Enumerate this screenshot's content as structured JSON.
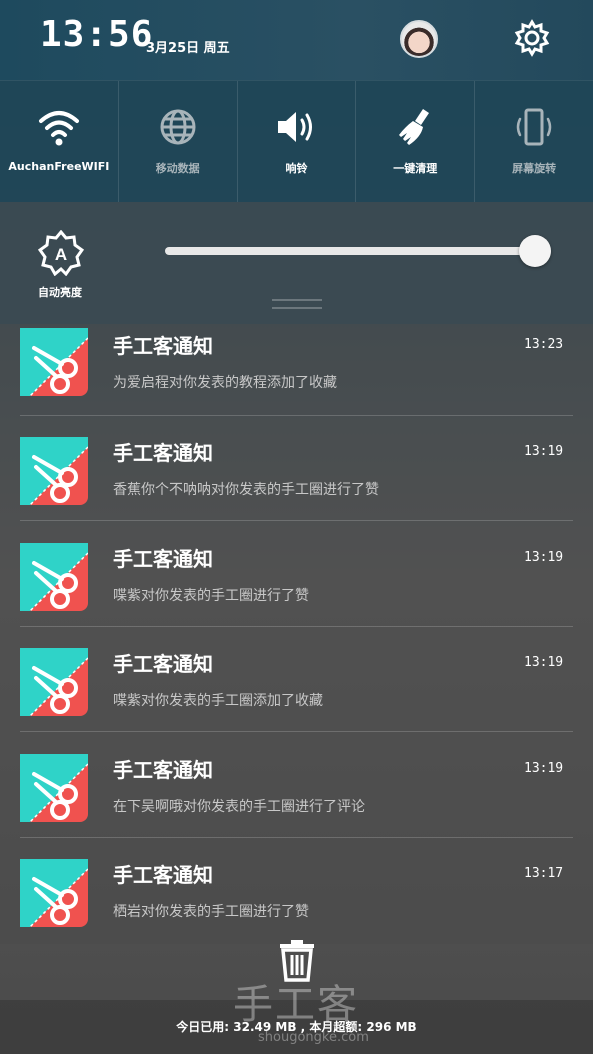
{
  "status": {
    "time": "13:56",
    "date": "3月25日 周五"
  },
  "toggles": [
    {
      "label": "AuchanFreeWIFI",
      "icon": "wifi-icon",
      "active": true
    },
    {
      "label": "移动数据",
      "icon": "globe-icon",
      "active": false
    },
    {
      "label": "响铃",
      "icon": "speaker-icon",
      "active": true
    },
    {
      "label": "一键清理",
      "icon": "broom-icon",
      "active": true
    },
    {
      "label": "屏幕旋转",
      "icon": "rotate-icon",
      "active": false
    }
  ],
  "brightness": {
    "auto_label": "自动亮度",
    "level": 1.0
  },
  "notifications": [
    {
      "title": "手工客通知",
      "time": "13:23",
      "body": "为爱启程对你发表的教程添加了收藏"
    },
    {
      "title": "手工客通知",
      "time": "13:19",
      "body": "香蕉你个不呐呐对你发表的手工圈进行了赞"
    },
    {
      "title": "手工客通知",
      "time": "13:19",
      "body": "喋紫对你发表的手工圈进行了赞"
    },
    {
      "title": "手工客通知",
      "time": "13:19",
      "body": "喋紫对你发表的手工圈添加了收藏"
    },
    {
      "title": "手工客通知",
      "time": "13:19",
      "body": "在下吴啊哦对你发表的手工圈进行了评论"
    },
    {
      "title": "手工客通知",
      "time": "13:17",
      "body": "栖岩对你发表的手工圈进行了赞"
    }
  ],
  "usage": "今日已用: 32.49 MB , 本月超额: 296 MB",
  "watermark": {
    "text": "手工客",
    "url": "shougongke.com"
  },
  "colors": {
    "app_teal": "#2fd3c8",
    "app_red": "#f0524f"
  }
}
